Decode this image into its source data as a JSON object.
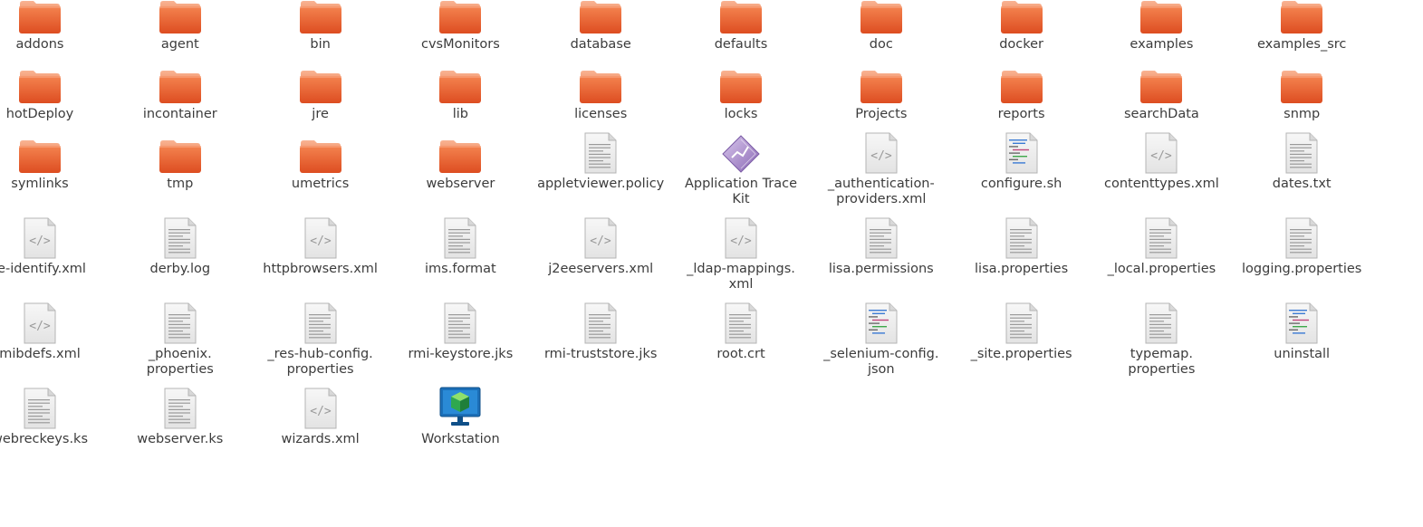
{
  "colors": {
    "folder_top": "#f7a37e",
    "folder_body": "#e8592a",
    "file_paper": "#ececec",
    "text": "#3c3c3c"
  },
  "items": [
    {
      "label": "addons",
      "icon": "folder-icon"
    },
    {
      "label": "agent",
      "icon": "folder-icon"
    },
    {
      "label": "bin",
      "icon": "folder-icon"
    },
    {
      "label": "cvsMonitors",
      "icon": "folder-icon"
    },
    {
      "label": "database",
      "icon": "folder-icon"
    },
    {
      "label": "defaults",
      "icon": "folder-icon"
    },
    {
      "label": "doc",
      "icon": "folder-icon"
    },
    {
      "label": "docker",
      "icon": "folder-icon"
    },
    {
      "label": "examples",
      "icon": "folder-icon"
    },
    {
      "label": "examples_src",
      "icon": "folder-icon"
    },
    {
      "label": "hotDeploy",
      "icon": "folder-icon"
    },
    {
      "label": "incontainer",
      "icon": "folder-icon"
    },
    {
      "label": "jre",
      "icon": "folder-icon"
    },
    {
      "label": "lib",
      "icon": "folder-icon"
    },
    {
      "label": "licenses",
      "icon": "folder-icon"
    },
    {
      "label": "locks",
      "icon": "folder-icon"
    },
    {
      "label": "Projects",
      "icon": "folder-icon"
    },
    {
      "label": "reports",
      "icon": "folder-icon"
    },
    {
      "label": "searchData",
      "icon": "folder-icon"
    },
    {
      "label": "snmp",
      "icon": "folder-icon"
    },
    {
      "label": "symlinks",
      "icon": "folder-icon"
    },
    {
      "label": "tmp",
      "icon": "folder-icon"
    },
    {
      "label": "umetrics",
      "icon": "folder-icon"
    },
    {
      "label": "webserver",
      "icon": "folder-icon"
    },
    {
      "label": "appletviewer.policy",
      "icon": "text-file-icon"
    },
    {
      "label": "Application Trace\nKit",
      "icon": "application-icon"
    },
    {
      "label": "_authentication-\nproviders.xml",
      "icon": "xml-file-icon"
    },
    {
      "label": "configure.sh",
      "icon": "script-file-icon"
    },
    {
      "label": "contenttypes.xml",
      "icon": "xml-file-icon"
    },
    {
      "label": "dates.txt",
      "icon": "text-file-icon"
    },
    {
      "label": "le-identify.xml",
      "icon": "xml-file-icon"
    },
    {
      "label": "derby.log",
      "icon": "text-file-icon"
    },
    {
      "label": "httpbrowsers.xml",
      "icon": "xml-file-icon"
    },
    {
      "label": "ims.format",
      "icon": "text-file-icon"
    },
    {
      "label": "j2eeservers.xml",
      "icon": "xml-file-icon"
    },
    {
      "label": "_ldap-mappings.\nxml",
      "icon": "xml-file-icon"
    },
    {
      "label": "lisa.permissions",
      "icon": "text-file-icon"
    },
    {
      "label": "lisa.properties",
      "icon": "text-file-icon"
    },
    {
      "label": "_local.properties",
      "icon": "text-file-icon"
    },
    {
      "label": "logging.properties",
      "icon": "text-file-icon"
    },
    {
      "label": "mibdefs.xml",
      "icon": "xml-file-icon"
    },
    {
      "label": "_phoenix.\nproperties",
      "icon": "text-file-icon"
    },
    {
      "label": "_res-hub-config.\nproperties",
      "icon": "text-file-icon"
    },
    {
      "label": "rmi-keystore.jks",
      "icon": "text-file-icon"
    },
    {
      "label": "rmi-truststore.jks",
      "icon": "text-file-icon"
    },
    {
      "label": "root.crt",
      "icon": "text-file-icon"
    },
    {
      "label": "_selenium-config.\njson",
      "icon": "script-file-icon"
    },
    {
      "label": "_site.properties",
      "icon": "text-file-icon"
    },
    {
      "label": "typemap.\nproperties",
      "icon": "text-file-icon"
    },
    {
      "label": "uninstall",
      "icon": "script-file-icon"
    },
    {
      "label": "webreckeys.ks",
      "icon": "text-file-icon"
    },
    {
      "label": "webserver.ks",
      "icon": "text-file-icon"
    },
    {
      "label": "wizards.xml",
      "icon": "xml-file-icon"
    },
    {
      "label": "Workstation",
      "icon": "workstation-icon"
    }
  ]
}
